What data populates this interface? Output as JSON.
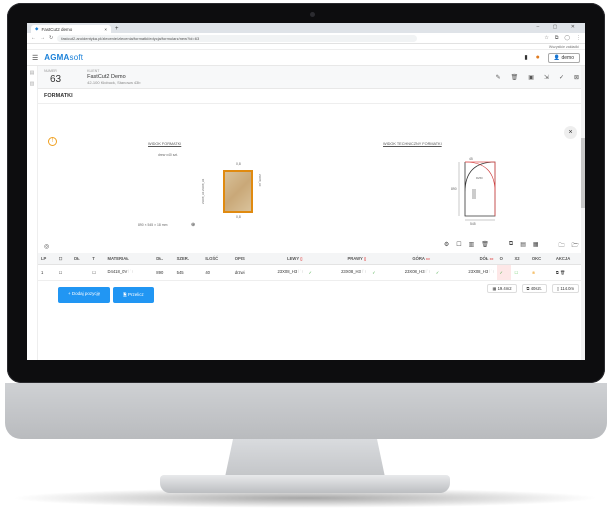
{
  "browser": {
    "tab_title": "FastCut2 demo",
    "url": "fastcut2.aroidentyka.pl/zlecenie/zlecenia/formatki/edycja/formularz/new?id=63",
    "bookmarks_label": "Wszystkie zakładki"
  },
  "app": {
    "logo_main": "AGMA",
    "logo_sub": "soft",
    "user_label": "demo"
  },
  "order": {
    "number_label": "NUMER",
    "number": "63",
    "client_label": "KLIENT",
    "client_name": "FastCut2 Demo",
    "client_address": "42-100 Kłobuck, Stanowa 43b"
  },
  "section_title": "FORMATKI",
  "preview": {
    "left_title": "WIDOK FORMATKI",
    "left_caption": "drew  x40 szt.",
    "dims_text": "890 × 545 × 18 mm",
    "edge_top": "0,8",
    "edge_bottom": "0,8",
    "edge_left": "23X08_H3 23X08_H3",
    "edge_right": "23X08_H3",
    "right_title": "WIDOK TECHNICZNY FORMATKI",
    "tech_dim_top": "45",
    "tech_dim_left": "890",
    "tech_dim_bottom": "545",
    "tech_radius": "R250"
  },
  "table": {
    "headers": [
      "LP",
      "☐",
      "DŁ",
      "T",
      "MATERIAŁ",
      "DŁ.",
      "SZER.",
      "ILOŚĆ",
      "OPIS",
      "LEWY",
      "PRAWY",
      "GÓRA",
      "DÓŁ",
      "O",
      "X2",
      "OKC",
      "AKCJA"
    ],
    "row": {
      "lp": "1",
      "material": "D4418_0V",
      "length": "890",
      "width": "545",
      "qty": "40",
      "desc": "drzwi",
      "left": "23X08_H3",
      "right": "23X08_H3",
      "top": "23X08_H3",
      "bottom": "23X08_H3"
    }
  },
  "totals": {
    "area": "19.4m2",
    "count": "40szt.",
    "edging": "114.0m"
  },
  "buttons": {
    "add_item": "+ Dodaj pozycję",
    "calculate": "Przelicz"
  }
}
